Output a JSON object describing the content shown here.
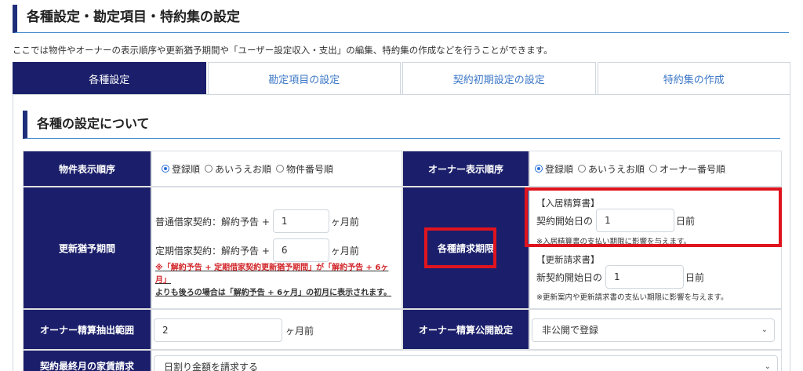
{
  "page": {
    "title": "各種設定・勘定項目・特約集の設定",
    "description": "ここでは物件やオーナーの表示順序や更新猶予期間や「ユーザー設定収入・支出」の編集、特約集の作成などを行うことができます。"
  },
  "tabs": [
    {
      "label": "各種設定",
      "active": true
    },
    {
      "label": "勘定項目の設定",
      "active": false
    },
    {
      "label": "契約初期設定の設定",
      "active": false
    },
    {
      "label": "特約集の作成",
      "active": false
    }
  ],
  "section": {
    "title": "各種の設定について"
  },
  "property_order": {
    "label": "物件表示順序",
    "options": [
      "登録順",
      "あいうえお順",
      "物件番号順"
    ],
    "selected": "登録順"
  },
  "owner_order": {
    "label": "オーナー表示順序",
    "options": [
      "登録順",
      "あいうえお順",
      "オーナー番号順"
    ],
    "selected": "登録順"
  },
  "renewal": {
    "label": "更新猶予期間",
    "normal_label": "普通借家契約：解約予告 +",
    "normal_value": "1",
    "fixed_label": "定期借家契約：解約予告 +",
    "fixed_value": "6",
    "unit": "ヶ月前",
    "note_mark": "※",
    "note_red": "「解約予告 + 定期借家契約更新猶予期間」が「解約予告 + 6ヶ月」",
    "note_rest": "よりも後ろの場合は「解約予告 + 6ヶ月」の初月に表示されます。"
  },
  "billing": {
    "label": "各種請求期限",
    "move_in_heading": "【入居精算書】",
    "move_in_prefix": "契約開始日の",
    "move_in_value": "1",
    "move_in_suffix": "日前",
    "move_in_note": "※入居精算書の支払い期限に影響を与えます。",
    "renewal_heading": "【更新請求書】",
    "renewal_prefix": "新契約開始日の",
    "renewal_value": "1",
    "renewal_suffix": "日前",
    "renewal_note": "※更新案内や更新請求書の支払い期限に影響を与えます。"
  },
  "owner_extract": {
    "label": "オーナー精算抽出範囲",
    "value": "2",
    "unit": "ヶ月前"
  },
  "owner_publish": {
    "label": "オーナー精算公開設定",
    "selected": "非公開で登録"
  },
  "last_row": {
    "label": "契約最終月の家賃請求",
    "selected": "日割り金額を請求する"
  },
  "colors": {
    "header_bg": "#1b1f6b",
    "accent_blue": "#3d78c6",
    "highlight_red": "#e0141e"
  }
}
